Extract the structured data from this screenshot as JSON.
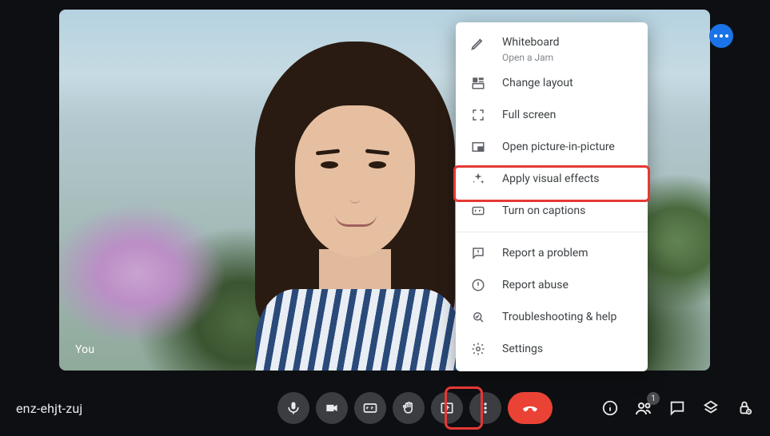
{
  "participantName": "You",
  "meetingCode": "enz-ehjt-zuj",
  "participantsCount": "1",
  "menu": {
    "whiteboard": {
      "label": "Whiteboard",
      "sub": "Open a Jam"
    },
    "changeLayout": "Change layout",
    "fullScreen": "Full screen",
    "pip": "Open picture-in-picture",
    "visualEffects": "Apply visual effects",
    "captions": "Turn on captions",
    "reportProblem": "Report a problem",
    "reportAbuse": "Report abuse",
    "troubleshoot": "Troubleshooting & help",
    "settings": "Settings"
  }
}
